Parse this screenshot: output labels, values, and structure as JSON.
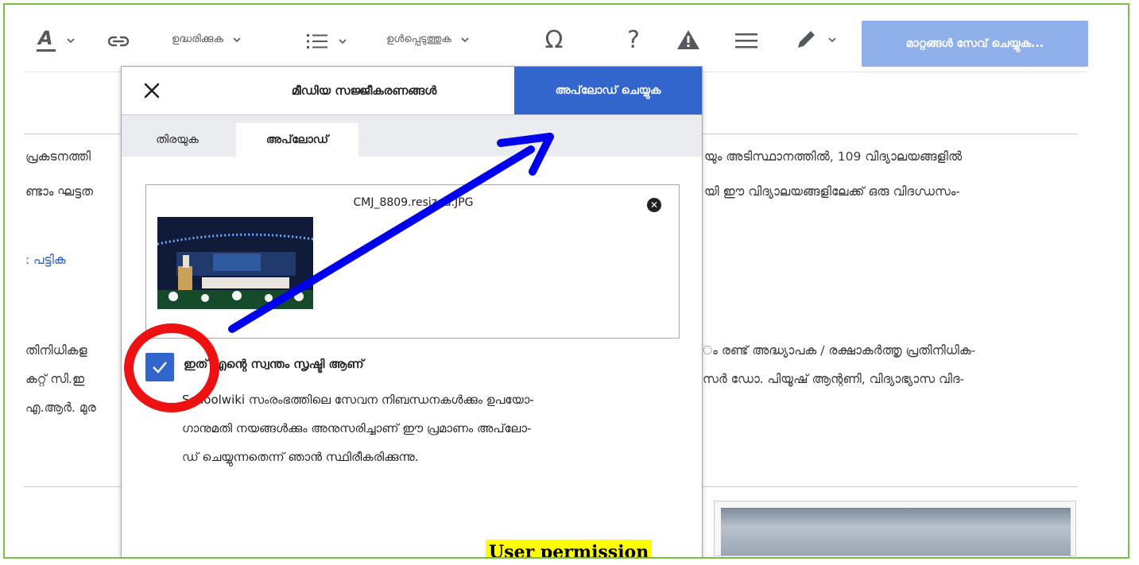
{
  "toolbar": {
    "quote_label": "ഉദ്ധരിക്കുക",
    "insert_label": "ഉൾപ്പെടുത്തുക",
    "save_label": "മാറ്റങ്ങൾ സേവ് ചെയ്യുക..."
  },
  "page_text": {
    "line1_left": "പ്രകടനത്തി",
    "line1_right": "യും അടിസ്ഥാനത്തിൽ, 109 വിദ്യാലയങ്ങളിൽ",
    "line2_left": "ണ്ടാം ഘട്ടത",
    "line2_right": "യി ഈ വിദ്യാലയങ്ങളിലേക്ക് ഒരു വിദഗ്ധസം-",
    "link_text": "പട്ടിക",
    "line3_left": "തിനിധികള",
    "line3_right": "ം രണ്ട് അദ്ധ്യാപക / രക്ഷാകർത്തൃ പ്രതിനിധിക-",
    "line4_left": "കറ്റ് സി.ഇ",
    "line4_right": "സർ ഡോ. പിയൂഷ് ആന്റണി, വിദ്യാഭ്യാസ വിദ-",
    "line5_left": "എ.ആർ. മുര"
  },
  "dialog": {
    "title": "മീഡിയ സജ്ജീകരണങ്ങൾ",
    "upload_button": "അപ്‌ലോഡ് ചെയ്യുക",
    "tabs": [
      "തിരയുക",
      "അപ്‌ലോഡ്"
    ],
    "file_name": "CMJ_8809.resized.JPG",
    "own_work_label": "ഇത് എന്റെ സ്വന്തം സൃഷ്ടി ആണ്",
    "terms_lines": [
      "Schoolwiki സംരംഭത്തിലെ സേവന നിബന്ധനകൾക്കും ഉപയോ-",
      "ഗാനുമതി നയങ്ങൾക്കും അനുസരിച്ചാണ് ഈ പ്രമാണം അപ്‌ലോ-",
      "ഡ് ചെയ്യുന്നതെന്ന് ഞാൻ സ്ഥിരീകരിക്കുന്നു."
    ]
  },
  "caption": "User permission",
  "colors": {
    "frame_border": "#7ac143",
    "progressive": "#3366cc",
    "save_disabled": "#8fb0eb",
    "annotation_arrow": "#0000ee",
    "annotation_circle": "#ee1111",
    "caption_bg": "#ffff00"
  },
  "icons": [
    "text-style-icon",
    "link-icon",
    "list-icon",
    "special-character-icon",
    "help-icon",
    "notice-icon",
    "menu-icon",
    "edit-pencil-icon",
    "close-icon",
    "checkmark-icon",
    "remove-file-icon"
  ]
}
